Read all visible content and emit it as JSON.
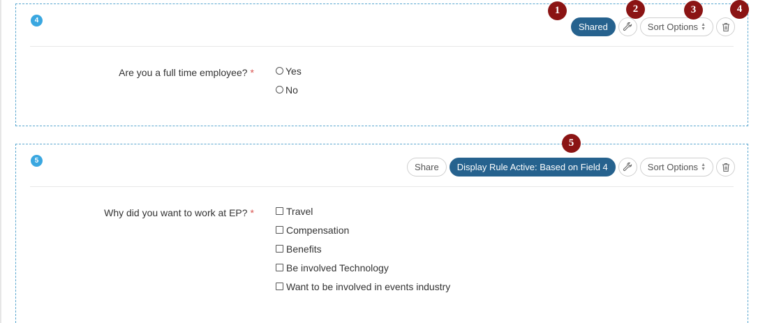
{
  "fields": [
    {
      "number": "4",
      "toolbar": {
        "shared_label": "Shared",
        "sort_label": "Sort Options"
      },
      "question": "Are you a full time employee?",
      "required_mark": "*",
      "option_type": "radio",
      "options": [
        "Yes",
        "No"
      ]
    },
    {
      "number": "5",
      "toolbar": {
        "share_label": "Share",
        "rule_label": "Display Rule Active: Based on Field 4",
        "sort_label": "Sort Options"
      },
      "question": "Why did you want to work at EP?",
      "required_mark": "*",
      "option_type": "checkbox",
      "options": [
        "Travel",
        "Compensation",
        "Benefits",
        "Be involved Technology",
        "Want to be involved in events industry"
      ]
    }
  ],
  "markers": [
    "1",
    "2",
    "3",
    "4",
    "5"
  ],
  "icons": {
    "settings": "wrench-icon",
    "sort": "sort-arrows-icon",
    "delete": "trash-icon"
  },
  "colors": {
    "accent_blue": "#26628e",
    "badge_blue": "#3aa7e0",
    "dashed_border": "#58a6cf",
    "marker_red": "#8b1414",
    "required_red": "#d9534f"
  }
}
